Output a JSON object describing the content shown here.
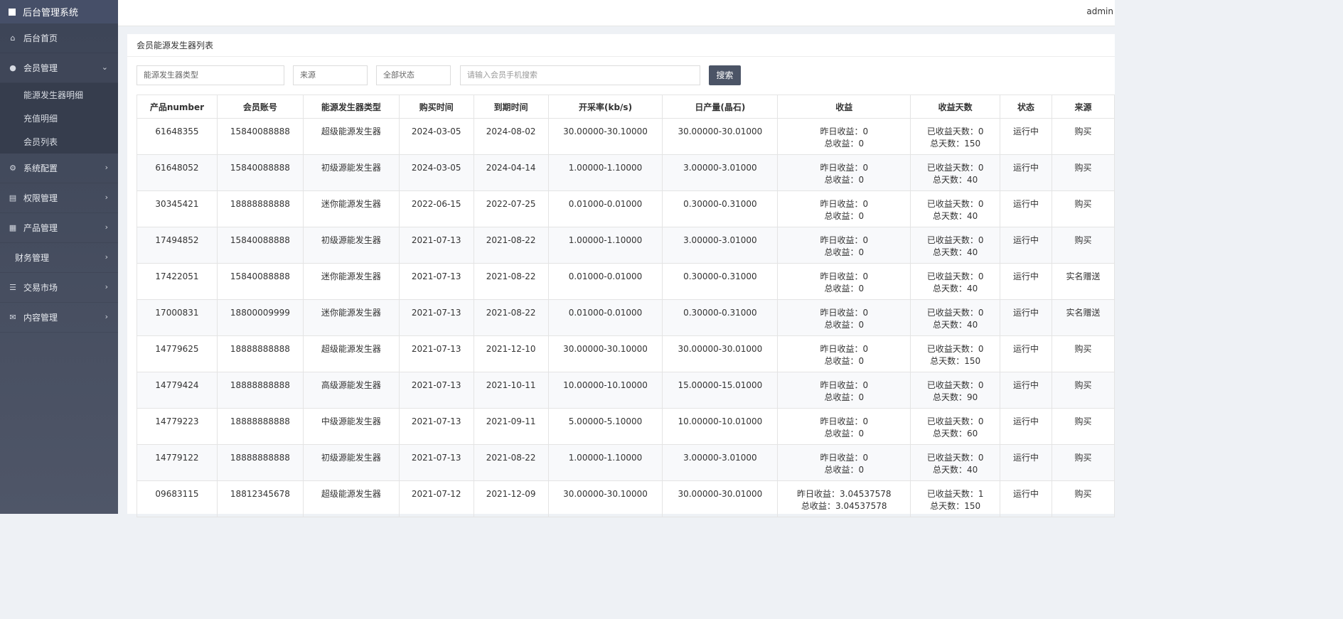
{
  "app": {
    "title": "后台管理系统",
    "user": "admin"
  },
  "sidebar": {
    "items": [
      {
        "label": "后台首页",
        "icon": "home-icon"
      },
      {
        "label": "会员管理",
        "icon": "user-icon",
        "open": true,
        "children": [
          "能源发生器明细",
          "充值明细",
          "会员列表"
        ]
      },
      {
        "label": "系统配置",
        "icon": "gears-icon"
      },
      {
        "label": "权限管理",
        "icon": "id-card-icon"
      },
      {
        "label": "产品管理",
        "icon": "windows-icon"
      },
      {
        "label": "财务管理",
        "icon": ""
      },
      {
        "label": "交易市场",
        "icon": "list-icon"
      },
      {
        "label": "内容管理",
        "icon": "envelope-icon"
      }
    ]
  },
  "panel": {
    "title": "会员能源发生器列表",
    "filters": {
      "type": "能源发生器类型",
      "source": "来源",
      "status": "全部状态",
      "phone_placeholder": "请输入会员手机搜索",
      "search_button": "搜索"
    }
  },
  "table": {
    "headers": [
      "产品number",
      "会员账号",
      "能源发生器类型",
      "购买时间",
      "到期时间",
      "开采率(kb/s)",
      "日产量(晶石)",
      "收益",
      "收益天数",
      "状态",
      "来源"
    ],
    "rows": [
      [
        "61648355",
        "15840088888",
        "超级能源发生器",
        "2024-03-05",
        "2024-08-02",
        "30.00000-30.10000",
        "30.00000-30.01000",
        "昨日收益：0",
        "总收益：0",
        "已收益天数：0",
        "总天数：150",
        "运行中",
        "购买"
      ],
      [
        "61648052",
        "15840088888",
        "初级源能发生器",
        "2024-03-05",
        "2024-04-14",
        "1.00000-1.10000",
        "3.00000-3.01000",
        "昨日收益：0",
        "总收益：0",
        "已收益天数：0",
        "总天数：40",
        "运行中",
        "购买"
      ],
      [
        "30345421",
        "18888888888",
        "迷你能源发生器",
        "2022-06-15",
        "2022-07-25",
        "0.01000-0.01000",
        "0.30000-0.31000",
        "昨日收益：0",
        "总收益：0",
        "已收益天数：0",
        "总天数：40",
        "运行中",
        "购买"
      ],
      [
        "17494852",
        "15840088888",
        "初级源能发生器",
        "2021-07-13",
        "2021-08-22",
        "1.00000-1.10000",
        "3.00000-3.01000",
        "昨日收益：0",
        "总收益：0",
        "已收益天数：0",
        "总天数：40",
        "运行中",
        "购买"
      ],
      [
        "17422051",
        "15840088888",
        "迷你能源发生器",
        "2021-07-13",
        "2021-08-22",
        "0.01000-0.01000",
        "0.30000-0.31000",
        "昨日收益：0",
        "总收益：0",
        "已收益天数：0",
        "总天数：40",
        "运行中",
        "实名赠送"
      ],
      [
        "17000831",
        "18800009999",
        "迷你能源发生器",
        "2021-07-13",
        "2021-08-22",
        "0.01000-0.01000",
        "0.30000-0.31000",
        "昨日收益：0",
        "总收益：0",
        "已收益天数：0",
        "总天数：40",
        "运行中",
        "实名赠送"
      ],
      [
        "14779625",
        "18888888888",
        "超级能源发生器",
        "2021-07-13",
        "2021-12-10",
        "30.00000-30.10000",
        "30.00000-30.01000",
        "昨日收益：0",
        "总收益：0",
        "已收益天数：0",
        "总天数：150",
        "运行中",
        "购买"
      ],
      [
        "14779424",
        "18888888888",
        "高级源能发生器",
        "2021-07-13",
        "2021-10-11",
        "10.00000-10.10000",
        "15.00000-15.01000",
        "昨日收益：0",
        "总收益：0",
        "已收益天数：0",
        "总天数：90",
        "运行中",
        "购买"
      ],
      [
        "14779223",
        "18888888888",
        "中级源能发生器",
        "2021-07-13",
        "2021-09-11",
        "5.00000-5.10000",
        "10.00000-10.01000",
        "昨日收益：0",
        "总收益：0",
        "已收益天数：0",
        "总天数：60",
        "运行中",
        "购买"
      ],
      [
        "14779122",
        "18888888888",
        "初级源能发生器",
        "2021-07-13",
        "2021-08-22",
        "1.00000-1.10000",
        "3.00000-3.01000",
        "昨日收益：0",
        "总收益：0",
        "已收益天数：0",
        "总天数：40",
        "运行中",
        "购买"
      ],
      [
        "09683115",
        "18812345678",
        "超级能源发生器",
        "2021-07-12",
        "2021-12-09",
        "30.00000-30.10000",
        "30.00000-30.01000",
        "昨日收益：3.04537578",
        "总收益：3.04537578",
        "已收益天数：1",
        "总天数：150",
        "运行中",
        "购买"
      ]
    ]
  }
}
